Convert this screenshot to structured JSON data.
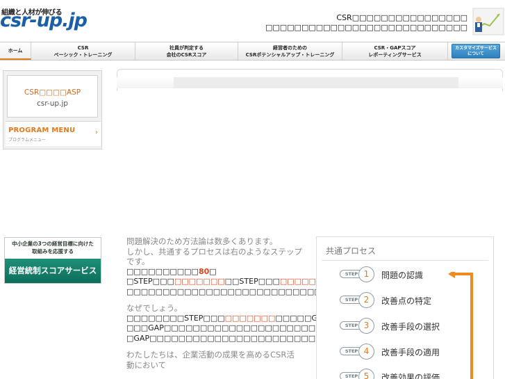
{
  "header": {
    "logo_tagline": "組織と人材が伸びる",
    "logo_main": "csr-up",
    "logo_tld": ".jp",
    "tagline_line1": "CSR□□□□□□□□□□□□□□□□",
    "tagline_line2": "□□□□□□□□□□□□□□□□□□□□□□□□□□□□"
  },
  "nav": {
    "home": "ホーム",
    "item1_l1": "CSR",
    "item1_l2": "ベーシック・トレーニング",
    "item2_l1": "社員が判定する",
    "item2_l2": "会社のCSRスコア",
    "item3_l1": "経営者のための",
    "item3_l2": "CSRポテンシャルアップ・トレーニング",
    "item4_l1": "CSR・GAPスコア",
    "item4_l2": "レポーティングサービス",
    "custom_l1": "カスタマイズサービス",
    "custom_l2": "について"
  },
  "sidebar": {
    "asp_line1": "CSR□□□□ASP",
    "asp_line2": "csr-up.jp",
    "program_menu_title": "PROGRAM MENU",
    "program_menu_sub": "プログラムメニュー",
    "program_menu_arrow": "›",
    "banner_top_l1": "中小企業の3つの経営目標に向けた",
    "banner_top_l2": "取組みを応援する",
    "banner_bottom": "経営統制スコアサービス"
  },
  "content": {
    "intro_l1": "問題解決のため方法論は数多くあります。",
    "intro_l2": "しかし、共通するプロセスは右のようなステップ",
    "intro_l3": "です。",
    "p1_a": "□□□□□□□□□□",
    "p1_b": "80",
    "p1_c": "□",
    "p2_a": "□STEP□□□",
    "p2_b": "□□□□□□□",
    "p2_c": "□□STEP□□□",
    "p2_d": "□□□□□□□",
    "p2_e": "□□□□□□□□□",
    "p3": "□□□□□□□□□□□□□□□□□□□□□□□□□□□□□□□□□□□□□□□□□",
    "why": "なぜでしょう。",
    "p4_a": "□□□□□□□□STEP□□□",
    "p4_b": "□□□□□□□",
    "p4_c": "□□□□□GAP□□",
    "p5": "□□□GAP□□□□□□□□□□□□□□□□□□□□□□□□□□□□□□",
    "p6": "□GAP□□□□□□□□□□□□□□□□□□□□□□□",
    "outro_l1": "わたしたちは、企業活動の成果を高めるCSR活",
    "outro_l2": "動において"
  },
  "process": {
    "title": "共通プロセス",
    "step_tag": "STEP",
    "steps": [
      {
        "num": "1",
        "label": "問題の認識"
      },
      {
        "num": "2",
        "label": "改善点の特定"
      },
      {
        "num": "3",
        "label": "改善手段の選択"
      },
      {
        "num": "4",
        "label": "改善手段の適用"
      },
      {
        "num": "5",
        "label": "改善効果の評価"
      }
    ],
    "accent_color": "#e5781d"
  }
}
